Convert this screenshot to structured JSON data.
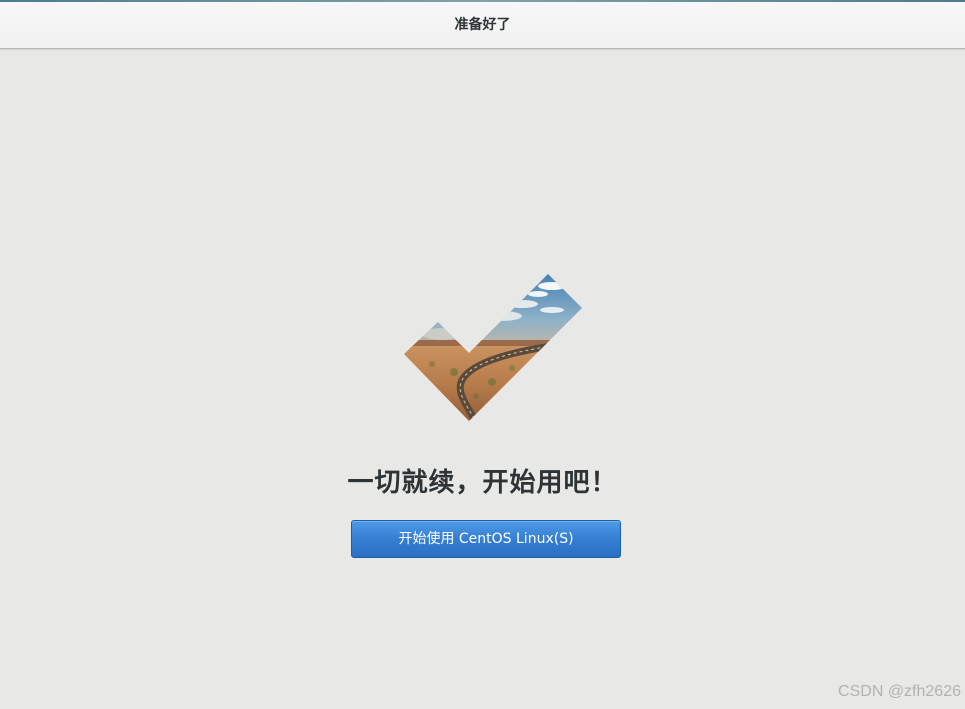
{
  "header": {
    "title": "准备好了"
  },
  "main": {
    "heading": "一切就续，开始用吧！",
    "start_button_label": "开始使用  CentOS Linux(S)"
  },
  "watermark": {
    "text": "CSDN @zfh2626"
  },
  "icons": {
    "hero": "checkmark-landscape-icon"
  },
  "colors": {
    "background": "#e8e8e7",
    "button_blue": "#357fd3",
    "text_dark": "#2e3436"
  }
}
